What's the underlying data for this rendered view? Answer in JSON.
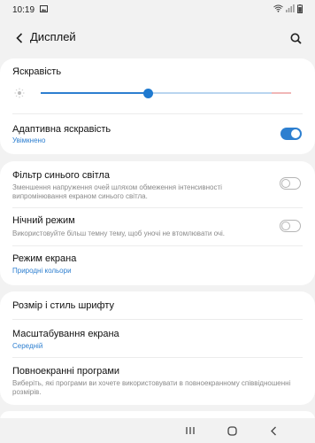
{
  "status_bar": {
    "time": "10:19"
  },
  "app_bar": {
    "title": "Дисплей"
  },
  "brightness": {
    "label": "Яскравість",
    "level_percent": 43,
    "adaptive_label": "Адаптивна яскравість",
    "adaptive_status": "Увімкнено",
    "adaptive_on": true
  },
  "blue_light": {
    "label": "Фільтр синього світла",
    "description": "Зменшення напруження очей шляхом обмеження інтенсивності випромінювання екраном синього світла.",
    "on": false
  },
  "night_mode": {
    "label": "Нічний режим",
    "description": "Використовуйте більш темну тему, щоб уночі не втомлювати очі.",
    "on": false
  },
  "screen_mode": {
    "label": "Режим екрана",
    "value": "Природні кольори"
  },
  "font": {
    "label": "Розмір і стиль шрифту"
  },
  "zoom": {
    "label": "Масштабування екрана",
    "value": "Середній"
  },
  "fullscreen_apps": {
    "label": "Повноекранні програми",
    "description": "Виберіть, які програми ви хочете використовувати в повноекранному співвідношенні розмірів."
  },
  "colors": {
    "accent": "#2d7fd0",
    "background": "#f2f2f2"
  }
}
